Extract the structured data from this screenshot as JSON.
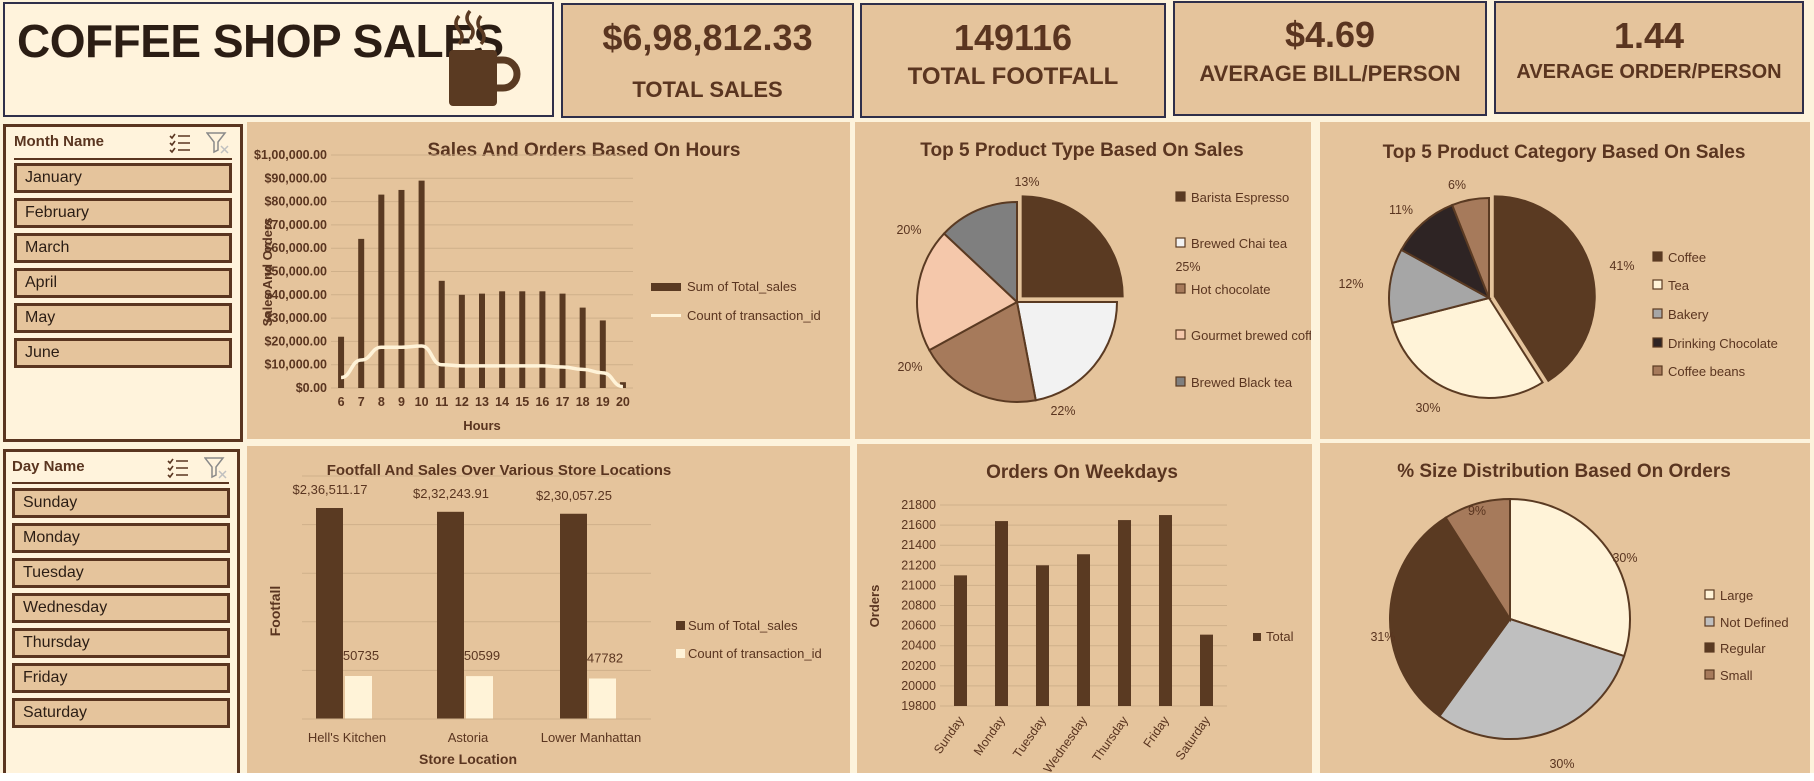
{
  "title": "COFFEE SHOP SALES",
  "kpis": [
    {
      "value": "$6,98,812.33",
      "label": "TOTAL SALES"
    },
    {
      "value": "149116",
      "label": "TOTAL FOOTFALL"
    },
    {
      "value": "$4.69",
      "label": "AVERAGE BILL/PERSON"
    },
    {
      "value": "1.44",
      "label": "AVERAGE ORDER/PERSON"
    }
  ],
  "month_slicer": {
    "header": "Month Name",
    "items": [
      "January",
      "February",
      "March",
      "April",
      "May",
      "June"
    ]
  },
  "day_slicer": {
    "header": "Day Name",
    "items": [
      "Sunday",
      "Monday",
      "Tuesday",
      "Wednesday",
      "Thursday",
      "Friday",
      "Saturday"
    ]
  },
  "colors": {
    "dark": "#5a3a22",
    "cream": "#fff3d8",
    "bg": "#e5c49c",
    "mid": "#a67a5b",
    "gray": "#7f7f7f",
    "peach": "#f5c8ab",
    "white": "#f2f2f2",
    "lightgray": "#bfbfbf",
    "black": "#2e2424",
    "text": "#5a3520"
  },
  "chart_data": [
    {
      "id": "hours",
      "type": "bar",
      "title": "Sales And Orders Based On Hours",
      "xlabel": "Hours",
      "ylabel": "Sales And Orders",
      "ylim": [
        0,
        100000
      ],
      "ytick_labels": [
        "$0.00",
        "$10,000.00",
        "$20,000.00",
        "$30,000.00",
        "$40,000.00",
        "$50,000.00",
        "$60,000.00",
        "$70,000.00",
        "$80,000.00",
        "$90,000.00",
        "$1,00,000.00"
      ],
      "categories": [
        "6",
        "7",
        "8",
        "9",
        "10",
        "11",
        "12",
        "13",
        "14",
        "15",
        "16",
        "17",
        "18",
        "19",
        "20"
      ],
      "series": [
        {
          "name": "Sum of Total_sales",
          "kind": "bar",
          "values": [
            22000,
            64000,
            83000,
            85000,
            89000,
            46000,
            40000,
            40500,
            41500,
            41500,
            41500,
            40500,
            34500,
            29000,
            2500
          ]
        },
        {
          "name": "Count of transaction_id",
          "kind": "line",
          "values": [
            4500,
            12000,
            17500,
            17500,
            18000,
            10000,
            9500,
            9500,
            9500,
            9500,
            9500,
            9000,
            8000,
            6500,
            600
          ]
        }
      ],
      "legend": "right"
    },
    {
      "id": "product_type",
      "type": "pie",
      "title": "Top 5  Product Type Based On Sales",
      "labels": [
        "Barista Espresso",
        "Brewed Chai tea",
        "Hot chocolate",
        "Gourmet brewed coffee",
        "Brewed Black tea"
      ],
      "values": [
        25,
        22,
        20,
        20,
        13
      ],
      "value_labels": [
        "25%",
        "22%",
        "20%",
        "20%",
        "13%"
      ],
      "colors": [
        "#5a3a22",
        "#f2f2f2",
        "#a67a5b",
        "#f5c8ab",
        "#7f7f7f"
      ],
      "legend": "right"
    },
    {
      "id": "product_category",
      "type": "pie",
      "title": "Top 5 Product Category Based On Sales",
      "labels": [
        "Coffee",
        "Tea",
        "Bakery",
        "Drinking Chocolate",
        "Coffee beans"
      ],
      "values": [
        41,
        30,
        12,
        11,
        6
      ],
      "value_labels": [
        "41%",
        "30%",
        "12%",
        "11%",
        "6%"
      ],
      "colors": [
        "#5a3a22",
        "#fff3d8",
        "#a6a6a6",
        "#2e2424",
        "#a67a5b"
      ],
      "legend": "right"
    },
    {
      "id": "stores",
      "type": "bar",
      "title": "Footfall And Sales Over Various Store Locations",
      "xlabel": "Store Location",
      "ylabel": "Footfall",
      "categories": [
        "Hell's Kitchen",
        "Astoria",
        "Lower Manhattan"
      ],
      "series": [
        {
          "name": "Sum of Total_sales",
          "values": [
            236511.17,
            232243.91,
            230057.25
          ],
          "value_labels": [
            "$2,36,511.17",
            "$2,32,243.91",
            "$2,30,057.25"
          ]
        },
        {
          "name": "Count of transaction_id",
          "values": [
            50735,
            50599,
            47782
          ],
          "value_labels": [
            "50735",
            "50599",
            "47782"
          ]
        }
      ],
      "legend": "right"
    },
    {
      "id": "weekdays",
      "type": "bar",
      "title": "Orders On Weekdays",
      "ylabel": "Orders",
      "ylim": [
        19800,
        21800
      ],
      "ytick_labels": [
        "19800",
        "20000",
        "20200",
        "20400",
        "20600",
        "20800",
        "21000",
        "21200",
        "21400",
        "21600",
        "21800"
      ],
      "categories": [
        "Sunday",
        "Monday",
        "Tuesday",
        "Wednesday",
        "Thursday",
        "Friday",
        "Saturday"
      ],
      "series": [
        {
          "name": "Total",
          "values": [
            21100,
            21640,
            21200,
            21310,
            21650,
            21700,
            20510
          ]
        }
      ],
      "legend": "right"
    },
    {
      "id": "sizes",
      "type": "pie",
      "title": "% Size Distribution Based On Orders",
      "labels": [
        "Large",
        "Not Defined",
        "Regular",
        "Small"
      ],
      "values": [
        30,
        30,
        31,
        9
      ],
      "value_labels": [
        "30%",
        "30%",
        "31%",
        "9%"
      ],
      "colors": [
        "#fff3d8",
        "#bfbfbf",
        "#5a3a22",
        "#a67a5b"
      ],
      "legend": "right"
    }
  ]
}
